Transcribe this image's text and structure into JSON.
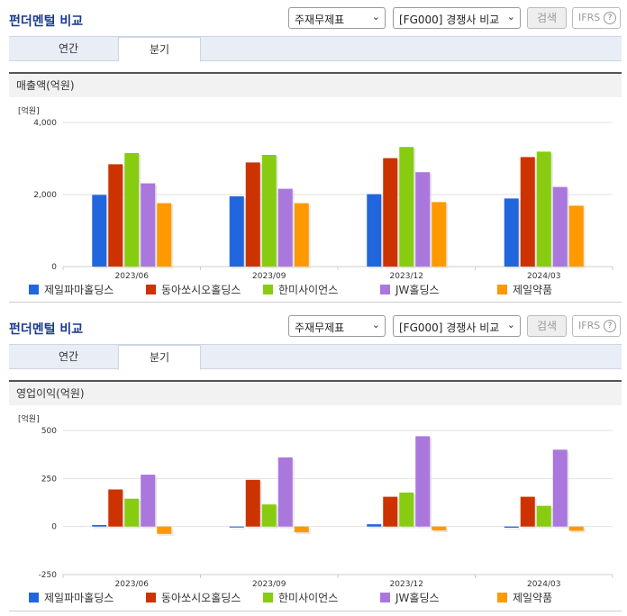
{
  "panels": [
    {
      "title": "펀더멘털 비교",
      "select1": "주재무제표",
      "select2": "[FG000] 경쟁사 비교",
      "search_label": "검색",
      "ifrs_label": "IFRS",
      "tabs": [
        "연간",
        "분기"
      ],
      "section_label": "매출액(억원)"
    },
    {
      "title": "펀더멘털 비교",
      "select1": "주재무제표",
      "select2": "[FG000] 경쟁사 비교",
      "search_label": "검색",
      "ifrs_label": "IFRS",
      "tabs": [
        "연간",
        "분기"
      ],
      "section_label": "영업이익(억원)"
    }
  ],
  "colors": {
    "series": [
      "#2266dd",
      "#cc3300",
      "#88cc11",
      "#aa77dd",
      "#ff9900"
    ],
    "title": "#1a3a8a"
  },
  "chart_data": [
    {
      "type": "bar",
      "unit_label": "[억원]",
      "categories": [
        "2023/06",
        "2023/09",
        "2023/12",
        "2024/03"
      ],
      "ylim": [
        0,
        4000
      ],
      "yticks": [
        0,
        2000,
        4000
      ],
      "ytick_labels": [
        "0",
        "2,000",
        "4,000"
      ],
      "grid": true,
      "legend": "bottom",
      "series": [
        {
          "name": "제일파마홀딩스",
          "values": [
            1990,
            1950,
            2010,
            1890
          ]
        },
        {
          "name": "동아쏘시오홀딩스",
          "values": [
            2840,
            2890,
            3010,
            3040
          ]
        },
        {
          "name": "한미사이언스",
          "values": [
            3150,
            3100,
            3320,
            3190
          ]
        },
        {
          "name": "JW홀딩스",
          "values": [
            2310,
            2160,
            2620,
            2210
          ]
        },
        {
          "name": "제일약품",
          "values": [
            1760,
            1760,
            1790,
            1690
          ]
        }
      ]
    },
    {
      "type": "bar",
      "unit_label": "[억원]",
      "categories": [
        "2023/06",
        "2023/09",
        "2023/12",
        "2024/03"
      ],
      "ylim": [
        -250,
        500
      ],
      "yticks": [
        -250,
        0,
        250,
        500
      ],
      "ytick_labels": [
        "-250",
        "0",
        "250",
        "500"
      ],
      "grid": true,
      "legend": "bottom",
      "series": [
        {
          "name": "제일파마홀딩스",
          "values": [
            8,
            -5,
            12,
            -6
          ]
        },
        {
          "name": "동아쏘시오홀딩스",
          "values": [
            193,
            243,
            155,
            155
          ]
        },
        {
          "name": "한미사이언스",
          "values": [
            145,
            115,
            177,
            108
          ]
        },
        {
          "name": "JW홀딩스",
          "values": [
            270,
            360,
            470,
            400
          ]
        },
        {
          "name": "제일약품",
          "values": [
            -38,
            -30,
            -20,
            -22
          ]
        }
      ]
    }
  ]
}
